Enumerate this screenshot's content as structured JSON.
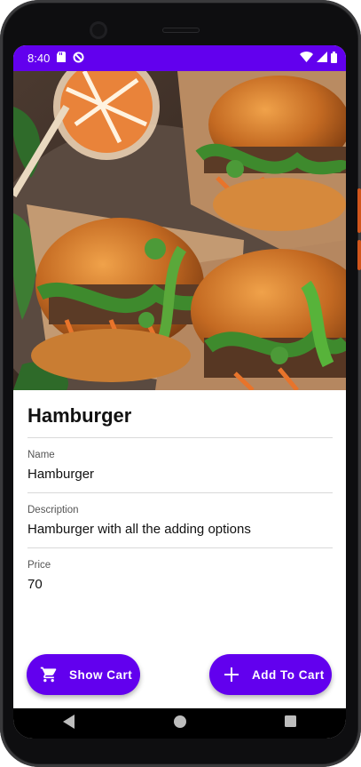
{
  "status_bar": {
    "time": "8:40",
    "icons": [
      "sd-card-icon",
      "data-saver-icon",
      "wifi-icon",
      "signal-icon",
      "battery-icon"
    ]
  },
  "product": {
    "title": "Hamburger",
    "image_alt": "Hamburger photo",
    "fields": [
      {
        "label": "Name",
        "value": "Hamburger"
      },
      {
        "label": "Description",
        "value": "Hamburger with all the adding options"
      },
      {
        "label": "Price",
        "value": "70"
      }
    ]
  },
  "actions": {
    "show_cart": "Show Cart",
    "add_to_cart": "Add To Cart"
  },
  "nav": {
    "icons": [
      "back-icon",
      "home-icon",
      "recents-icon"
    ]
  },
  "colors": {
    "accent": "#6200ee",
    "nav_background": "#000000"
  }
}
